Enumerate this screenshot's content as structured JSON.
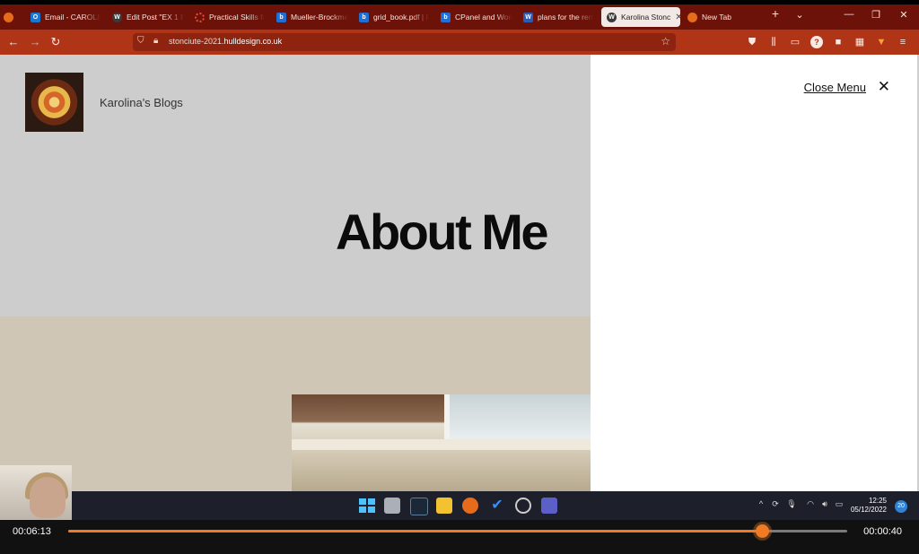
{
  "browser": {
    "tabs": [
      {
        "label": "Email - CAROLIN",
        "icon": "outlook-icon",
        "color": "#1877d2"
      },
      {
        "label": "Edit Post \"EX 1 Ba",
        "icon": "wordpress-icon",
        "color": "#3a3a3a"
      },
      {
        "label": "Practical Skills for",
        "icon": "spinner-icon",
        "color": "#e64b3c"
      },
      {
        "label": "Mueller-Brockma",
        "icon": "box-icon",
        "color": "#1f6fd6"
      },
      {
        "label": "grid_book.pdf | Po",
        "icon": "box-icon",
        "color": "#1f6fd6"
      },
      {
        "label": "CPanel and Word",
        "icon": "box-icon",
        "color": "#1f6fd6"
      },
      {
        "label": "plans for the rem",
        "icon": "word-icon",
        "color": "#2b5bb8"
      },
      {
        "label": "Karolina Stonc",
        "icon": "wordpress-icon",
        "color": "#3a3a3a"
      },
      {
        "label": "New Tab",
        "icon": "firefox-icon",
        "color": "#e66b1a"
      }
    ],
    "url_prefix": "stonciute-2021.",
    "url_domain": "hulldesign.co.uk"
  },
  "page": {
    "site_name": "Karolina's Blogs",
    "title": "About Me",
    "close_menu": "Close Menu",
    "close_glyph": "✕"
  },
  "taskbar": {
    "time": "12:25",
    "date": "05/12/2022",
    "notifications": "20"
  },
  "player": {
    "elapsed": "00:06:13",
    "remaining": "00:00:40",
    "progress": 0.89
  },
  "colors": {
    "tab_strip": "#6d1209",
    "nav_bar": "#b03517",
    "accent": "#f07b24"
  }
}
